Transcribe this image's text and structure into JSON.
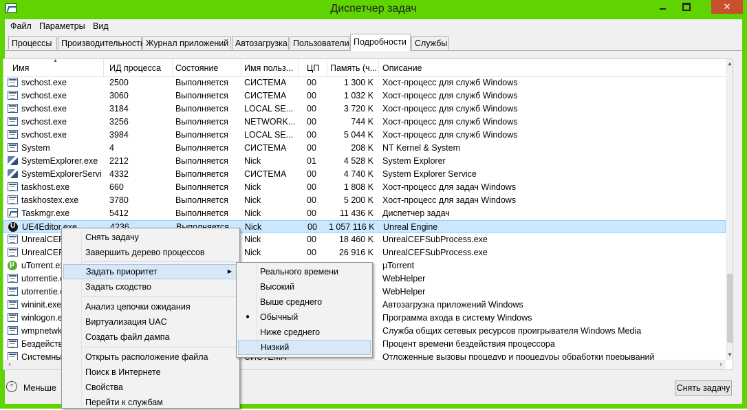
{
  "window": {
    "title": "Диспетчер задач",
    "close_glyph": "✕"
  },
  "menu": [
    "Файл",
    "Параметры",
    "Вид"
  ],
  "tabs": [
    "Процессы",
    "Производительность",
    "Журнал приложений",
    "Автозагрузка",
    "Пользователи",
    "Подробности",
    "Службы"
  ],
  "active_tab": "Подробности",
  "columns": [
    "Имя",
    "ИД процесса",
    "Состояние",
    "Имя польз...",
    "ЦП",
    "Память (ч...",
    "Описание"
  ],
  "sort_arrow": "▲",
  "rows": [
    {
      "icon": "window-icon",
      "name": "svchost.exe",
      "pid": "2500",
      "status": "Выполняется",
      "user": "СИСТЕМА",
      "cpu": "00",
      "mem": "1 300 K",
      "desc": "Хост-процесс для служб Windows"
    },
    {
      "icon": "window-icon",
      "name": "svchost.exe",
      "pid": "3060",
      "status": "Выполняется",
      "user": "СИСТЕМА",
      "cpu": "00",
      "mem": "1 032 K",
      "desc": "Хост-процесс для служб Windows"
    },
    {
      "icon": "window-icon",
      "name": "svchost.exe",
      "pid": "3184",
      "status": "Выполняется",
      "user": "LOCAL SE...",
      "cpu": "00",
      "mem": "3 720 K",
      "desc": "Хост-процесс для служб Windows"
    },
    {
      "icon": "window-icon",
      "name": "svchost.exe",
      "pid": "3256",
      "status": "Выполняется",
      "user": "NETWORK...",
      "cpu": "00",
      "mem": "744 K",
      "desc": "Хост-процесс для служб Windows"
    },
    {
      "icon": "window-icon",
      "name": "svchost.exe",
      "pid": "3984",
      "status": "Выполняется",
      "user": "LOCAL SE...",
      "cpu": "00",
      "mem": "5 044 K",
      "desc": "Хост-процесс для служб Windows"
    },
    {
      "icon": "window-icon",
      "name": "System",
      "pid": "4",
      "status": "Выполняется",
      "user": "СИСТЕМА",
      "cpu": "00",
      "mem": "208 K",
      "desc": "NT Kernel & System"
    },
    {
      "icon": "tool-icon",
      "name": "SystemExplorer.exe",
      "pid": "2212",
      "status": "Выполняется",
      "user": "Nick",
      "cpu": "01",
      "mem": "4 528 K",
      "desc": "System Explorer"
    },
    {
      "icon": "tool-icon",
      "name": "SystemExplorerServi...",
      "pid": "4332",
      "status": "Выполняется",
      "user": "СИСТЕМА",
      "cpu": "00",
      "mem": "4 740 K",
      "desc": "System Explorer Service"
    },
    {
      "icon": "window-icon",
      "name": "taskhost.exe",
      "pid": "660",
      "status": "Выполняется",
      "user": "Nick",
      "cpu": "00",
      "mem": "1 808 K",
      "desc": "Хост-процесс для задач Windows"
    },
    {
      "icon": "window-icon",
      "name": "taskhostex.exe",
      "pid": "3780",
      "status": "Выполняется",
      "user": "Nick",
      "cpu": "00",
      "mem": "5 200 K",
      "desc": "Хост-процесс для задач Windows"
    },
    {
      "icon": "chart-icon",
      "name": "Taskmgr.exe",
      "pid": "5412",
      "status": "Выполняется",
      "user": "Nick",
      "cpu": "00",
      "mem": "11 436 K",
      "desc": "Диспетчер задач"
    },
    {
      "icon": "unreal-icon",
      "name": "UE4Editor.exe",
      "pid": "4236",
      "status": "Выполняется",
      "user": "Nick",
      "cpu": "00",
      "mem": "1 057 116 K",
      "desc": "Unreal Engine"
    },
    {
      "icon": "window-icon",
      "name": "UnrealCEFS",
      "pid": "",
      "status": "",
      "user": "Nick",
      "cpu": "00",
      "mem": "18 460 K",
      "desc": "UnrealCEFSubProcess.exe"
    },
    {
      "icon": "window-icon",
      "name": "UnrealCEFS",
      "pid": "",
      "status": "",
      "user": "Nick",
      "cpu": "00",
      "mem": "26 916 K",
      "desc": "UnrealCEFSubProcess.exe"
    },
    {
      "icon": "utorrent-icon",
      "name": "uTorrent.ex",
      "pid": "",
      "status": "",
      "user": "",
      "cpu": "",
      "mem": "",
      "desc": "µTorrent"
    },
    {
      "icon": "window-icon",
      "name": "utorrentie.e",
      "pid": "",
      "status": "",
      "user": "",
      "cpu": "",
      "mem": "",
      "desc": "WebHelper"
    },
    {
      "icon": "window-icon",
      "name": "utorrentie.e",
      "pid": "",
      "status": "",
      "user": "",
      "cpu": "",
      "mem": "",
      "desc": "WebHelper"
    },
    {
      "icon": "window-icon",
      "name": "wininit.exe",
      "pid": "",
      "status": "",
      "user": "",
      "cpu": "",
      "mem": "",
      "desc": "Автозагрузка приложений Windows"
    },
    {
      "icon": "window-icon",
      "name": "winlogon.e",
      "pid": "",
      "status": "",
      "user": "",
      "cpu": "",
      "mem": "",
      "desc": "Программа входа в систему Windows"
    },
    {
      "icon": "window-icon",
      "name": "wmpnetwk",
      "pid": "",
      "status": "",
      "user": "",
      "cpu": "",
      "mem": "",
      "desc": "Служба общих сетевых ресурсов проигрывателя Windows Media"
    },
    {
      "icon": "window-icon",
      "name": "Бездействи",
      "pid": "",
      "status": "",
      "user": "",
      "cpu": "",
      "mem": "",
      "desc": "Процент времени бездействия процессора"
    },
    {
      "icon": "window-icon",
      "name": "Системны",
      "pid": "",
      "status": "",
      "user": "СИСТЕМА",
      "cpu": "",
      "mem": "",
      "desc": "Отложенные вызовы процедур и процедуры обработки прерываний"
    }
  ],
  "selected_row": 11,
  "context_menu": {
    "items": [
      "Снять задачу",
      "Завершить дерево процессов",
      "Задать приоритет",
      "Задать сходство",
      "Анализ цепочки ожидания",
      "Виртуализация UAC",
      "Создать файл дампа",
      "Открыть расположение файла",
      "Поиск в Интернете",
      "Свойства",
      "Перейти к службам"
    ],
    "highlighted": "Задать приоритет",
    "submenu_arrow": "▶"
  },
  "priority_submenu": {
    "items": [
      "Реального времени",
      "Высокий",
      "Выше среднего",
      "Обычный",
      "Ниже среднего",
      "Низкий"
    ],
    "checked": "Обычный",
    "highlighted": "Низкий",
    "bullet": "●"
  },
  "footer": {
    "less_label": "Меньше",
    "less_glyph": "⌃",
    "end_task_button": "Снять задачу"
  },
  "scrollbars": {
    "up": "▲",
    "down": "▼",
    "left": "‹",
    "right": "›"
  },
  "colors": {
    "window_border": "#5fd400",
    "close_button": "#c7502e",
    "selection": "#cce8ff",
    "menu_highlight": "#d9e8f7"
  }
}
